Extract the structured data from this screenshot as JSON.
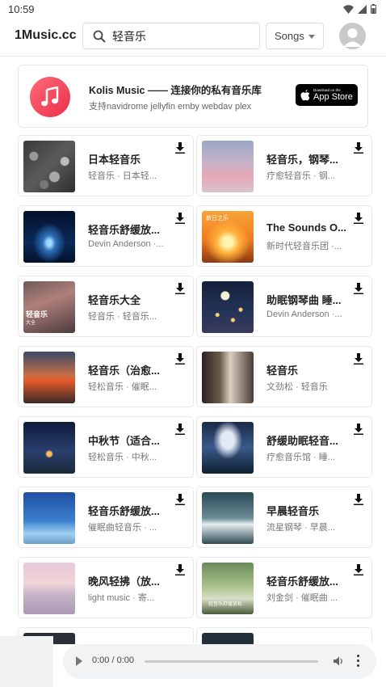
{
  "status": {
    "time": "10:59"
  },
  "header": {
    "app_title": "1Music.cc",
    "search": {
      "value": "轻音乐",
      "placeholder": ""
    },
    "type_select": "Songs"
  },
  "promo": {
    "title": "Kolis Music —— 连接你的私有音乐库",
    "subtitle": "支持navidrome jellyfin emby webdav plex",
    "appstore_small": "Download on the",
    "appstore_big": "App Store"
  },
  "songs": [
    {
      "title": "日本轻音乐",
      "meta": "轻音乐 · 日本轻..."
    },
    {
      "title": "轻音乐，钢琴...",
      "meta": "疗愈轻音乐 · 钢..."
    },
    {
      "title": "轻音乐舒缓放...",
      "meta": "Devin Anderson ·..."
    },
    {
      "title": "The Sounds O...",
      "meta": "新时代轻音乐团 ·..."
    },
    {
      "title": "轻音乐大全",
      "meta": "轻音乐 · 轻音乐..."
    },
    {
      "title": "助眠钢琴曲 睡...",
      "meta": "Devin Anderson ·..."
    },
    {
      "title": "轻音乐（治愈...",
      "meta": "轻松音乐 · 催眠..."
    },
    {
      "title": "轻音乐",
      "meta": "文劲松 · 轻音乐"
    },
    {
      "title": "中秋节（适合...",
      "meta": "轻松音乐 · 中秋..."
    },
    {
      "title": "舒缓助眠轻音...",
      "meta": "疗愈音乐馆 · 睡..."
    },
    {
      "title": "轻音乐舒缓放...",
      "meta": "催眠曲轻音乐 · ..."
    },
    {
      "title": "早晨轻音乐",
      "meta": "流星钢琴 · 早晨..."
    },
    {
      "title": "晚风轻拂（放...",
      "meta": "light music · 寄..."
    },
    {
      "title": "轻音乐舒缓放...",
      "meta": "刘金剑 · 催眠曲 ..."
    }
  ],
  "cover_text": {
    "s5_cover": "轻音乐",
    "s5_cover_sub": "大全",
    "s4_cover": "新日之乐",
    "s14_cover": "轻音乐舒缓放松"
  },
  "player": {
    "time": "0:00 / 0:00",
    "progress": 0
  },
  "colors": {
    "accent_red": "#ea2f4b",
    "text_primary": "#222222",
    "text_secondary": "#777777",
    "border": "#e8e8e8"
  },
  "icons": [
    "search-icon",
    "avatar-icon",
    "music-note-icon",
    "apple-icon",
    "download-icon",
    "play-icon",
    "volume-icon",
    "more-vert-icon"
  ]
}
